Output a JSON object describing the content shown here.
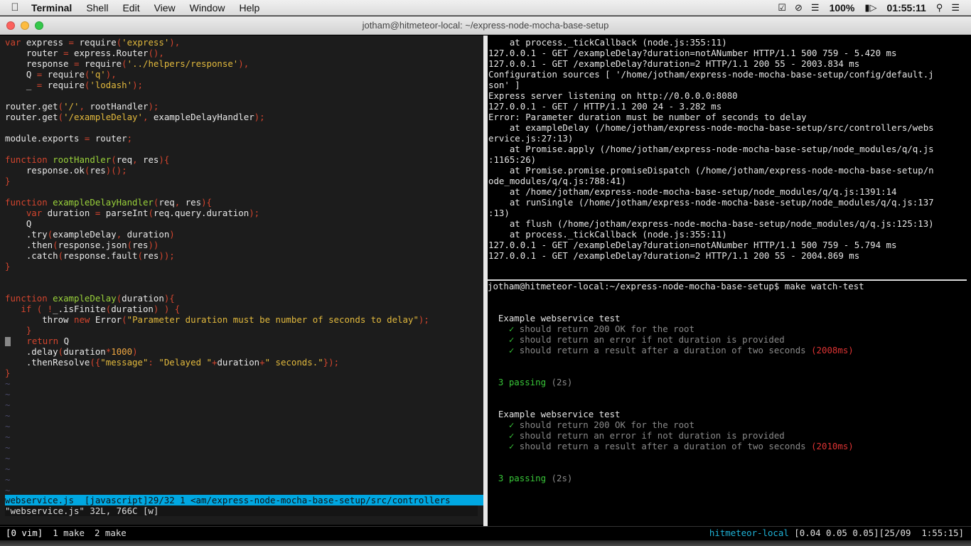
{
  "menubar": {
    "apple": "",
    "app": "Terminal",
    "items": [
      "Shell",
      "Edit",
      "View",
      "Window",
      "Help"
    ],
    "battery": "100%",
    "clock": "01:55:11"
  },
  "window": {
    "title": "jotham@hitmeteor-local: ~/express-node-mocha-base-setup"
  },
  "vim": {
    "status_line": "webservice.js  [javascript]29/32 1 <am/express-node-mocha-base-setup/src/controllers",
    "command_line": "\"webservice.js\" 32L, 766C [w]",
    "tilde": "~"
  },
  "right_top": [
    "    at process._tickCallback (node.js:355:11)",
    "127.0.0.1 - GET /exampleDelay?duration=notANumber HTTP/1.1 500 759 - 5.420 ms",
    "127.0.0.1 - GET /exampleDelay?duration=2 HTTP/1.1 200 55 - 2003.834 ms",
    "Configuration sources [ '/home/jotham/express-node-mocha-base-setup/config/default.j",
    "son' ]",
    "Express server listening on http://0.0.0.0:8080",
    "127.0.0.1 - GET / HTTP/1.1 200 24 - 3.282 ms",
    "Error: Parameter duration must be number of seconds to delay",
    "    at exampleDelay (/home/jotham/express-node-mocha-base-setup/src/controllers/webs",
    "ervice.js:27:13)",
    "    at Promise.apply (/home/jotham/express-node-mocha-base-setup/node_modules/q/q.js",
    ":1165:26)",
    "    at Promise.promise.promiseDispatch (/home/jotham/express-node-mocha-base-setup/n",
    "ode_modules/q/q.js:788:41)",
    "    at /home/jotham/express-node-mocha-base-setup/node_modules/q/q.js:1391:14",
    "    at runSingle (/home/jotham/express-node-mocha-base-setup/node_modules/q/q.js:137",
    ":13)",
    "    at flush (/home/jotham/express-node-mocha-base-setup/node_modules/q/q.js:125:13)",
    "    at process._tickCallback (node.js:355:11)",
    "127.0.0.1 - GET /exampleDelay?duration=notANumber HTTP/1.1 500 759 - 5.794 ms",
    "127.0.0.1 - GET /exampleDelay?duration=2 HTTP/1.1 200 55 - 2004.869 ms"
  ],
  "right_bottom": {
    "prompt": "jotham@hitmeteor-local:~/express-node-mocha-base-setup$ make watch-test",
    "runs": [
      {
        "suite": "Example webservice test",
        "tests": [
          "should return 200 OK for the root",
          "should return an error if not duration is provided",
          "should return a result after a duration of two seconds"
        ],
        "slow": "(2008ms)",
        "passing": "3 passing",
        "time": "(2s)"
      },
      {
        "suite": "Example webservice test",
        "tests": [
          "should return 200 OK for the root",
          "should return an error if not duration is provided",
          "should return a result after a duration of two seconds"
        ],
        "slow": "(2010ms)",
        "passing": "3 passing",
        "time": "(2s)"
      }
    ],
    "check": "✓"
  },
  "tmux": {
    "windows": [
      "[0 vim]",
      "1 make",
      "2 make"
    ],
    "host": "hitmeteor-local",
    "load": "[0.04 0.05 0.05]",
    "datetime": "[25/09  1:55:15]"
  }
}
